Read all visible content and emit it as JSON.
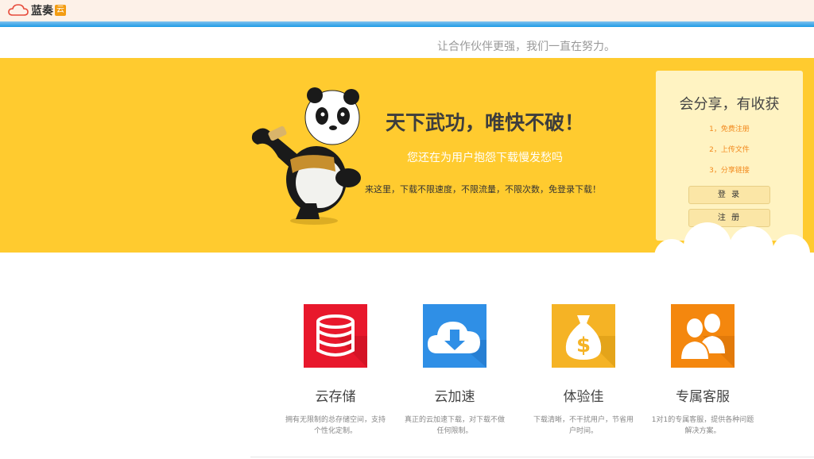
{
  "header": {
    "logo_text": "蓝奏",
    "logo_badge": "云"
  },
  "slogan": "让合作伙伴更强，我们一直在努力。",
  "banner": {
    "headline": "天下武功，唯快不破！",
    "subline": "您还在为用户抱怨下载慢发愁吗",
    "description": "来这里，下载不限速度，不限流量，不限次数，免登录下载！"
  },
  "login_box": {
    "title": "会分享，有收获",
    "steps": [
      "1，免费注册",
      "2，上传文件",
      "3，分享链接"
    ],
    "login_label": "登 录",
    "register_label": "注 册"
  },
  "features": [
    {
      "title": "云存储",
      "text": "拥有无限制的总存储空间，支持个性化定制。",
      "icon": "database-icon",
      "color": "#e8182c"
    },
    {
      "title": "云加速",
      "text": "真正的云加速下载，对下载不做任何限制。",
      "icon": "cloud-download-icon",
      "color": "#2f8fe6"
    },
    {
      "title": "体验佳",
      "text": "下载清晰，不干扰用户，节省用户时间。",
      "icon": "money-bag-icon",
      "color": "#f5b325"
    },
    {
      "title": "专属客服",
      "text": "1对1的专属客服，提供各种问题解决方案。",
      "icon": "customer-service-icon",
      "color": "#f4870e"
    }
  ],
  "colors": {
    "banner": "#ffcb2f",
    "accent_blue": "#1e9be5",
    "step_orange": "#f28a1e"
  }
}
